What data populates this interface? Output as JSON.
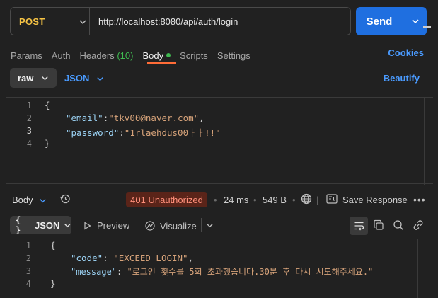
{
  "request": {
    "method": "POST",
    "url": "http://localhost:8080/api/auth/login",
    "send_label": "Send"
  },
  "tabs": [
    {
      "label": "Params"
    },
    {
      "label": "Auth"
    },
    {
      "label": "Headers",
      "count": "(10)"
    },
    {
      "label": "Body",
      "active": true
    },
    {
      "label": "Scripts"
    },
    {
      "label": "Settings"
    }
  ],
  "cookies_label": "Cookies",
  "body_mode": {
    "mode": "raw",
    "format": "JSON",
    "beautify_label": "Beautify"
  },
  "request_body": {
    "line_numbers": [
      "1",
      "2",
      "3",
      "4"
    ],
    "open": "{",
    "email_key": "\"email\"",
    "email_value": "\"tkv00@naver.com\"",
    "password_key": "\"password\"",
    "password_value": "\"1rlaehdus00ㅏㅏ!!\"",
    "close": "}"
  },
  "response": {
    "section_label": "Body",
    "status": "401 Unauthorized",
    "time": "24 ms",
    "size": "549 B",
    "save_label": "Save Response",
    "more_label": "•••",
    "view_mode": "JSON",
    "view_braces": "{ }",
    "preview_label": "Preview",
    "visualize_label": "Visualize",
    "status_color": "#ff8f7a"
  },
  "response_body": {
    "line_numbers": [
      "1",
      "2",
      "3",
      "4"
    ],
    "open": "{",
    "code_key": "\"code\"",
    "code_value": "\"EXCEED_LOGIN\"",
    "message_key": "\"message\"",
    "message_value": "\"로그인 횟수를 5회 초과했습니다.30분 후 다시 시도해주세요.\"",
    "close": "}"
  },
  "colors": {
    "accent": "#1f6fe0",
    "method": "#f6c344",
    "active_tab_underline": "#ff6c37",
    "link": "#4a9bff",
    "success_dot": "#3fb950"
  }
}
